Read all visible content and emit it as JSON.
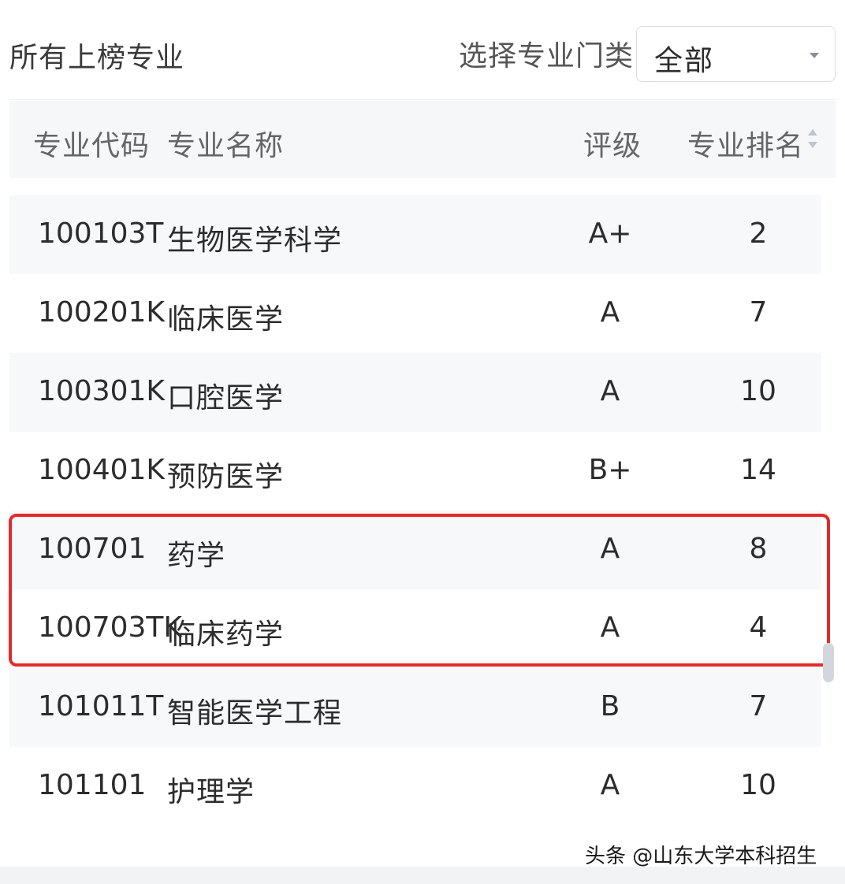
{
  "header": {
    "title": "所有上榜专业",
    "select_label": "选择专业门类",
    "select_value": "全部"
  },
  "table": {
    "columns": {
      "code": "专业代码",
      "name": "专业名称",
      "grade": "评级",
      "rank": "专业排名"
    },
    "rows": [
      {
        "code": "100103T",
        "name": "生物医学科学",
        "grade": "A+",
        "rank": "2"
      },
      {
        "code": "100201K",
        "name": "临床医学",
        "grade": "A",
        "rank": "7"
      },
      {
        "code": "100301K",
        "name": "口腔医学",
        "grade": "A",
        "rank": "10"
      },
      {
        "code": "100401K",
        "name": "预防医学",
        "grade": "B+",
        "rank": "14"
      },
      {
        "code": "100701",
        "name": "药学",
        "grade": "A",
        "rank": "8"
      },
      {
        "code": "100703TK",
        "name": "临床药学",
        "grade": "A",
        "rank": "4"
      },
      {
        "code": "101011T",
        "name": "智能医学工程",
        "grade": "B",
        "rank": "7"
      },
      {
        "code": "101101",
        "name": "护理学",
        "grade": "A",
        "rank": "10"
      }
    ]
  },
  "watermark": "头条 @山东大学本科招生",
  "colors": {
    "highlight_border": "#e02b2b",
    "header_bg": "#f6f7f9",
    "row_alt_bg": "#f7f8fa"
  },
  "icons": {
    "select_caret": "caret-down-icon",
    "sort": "sort-icon"
  }
}
